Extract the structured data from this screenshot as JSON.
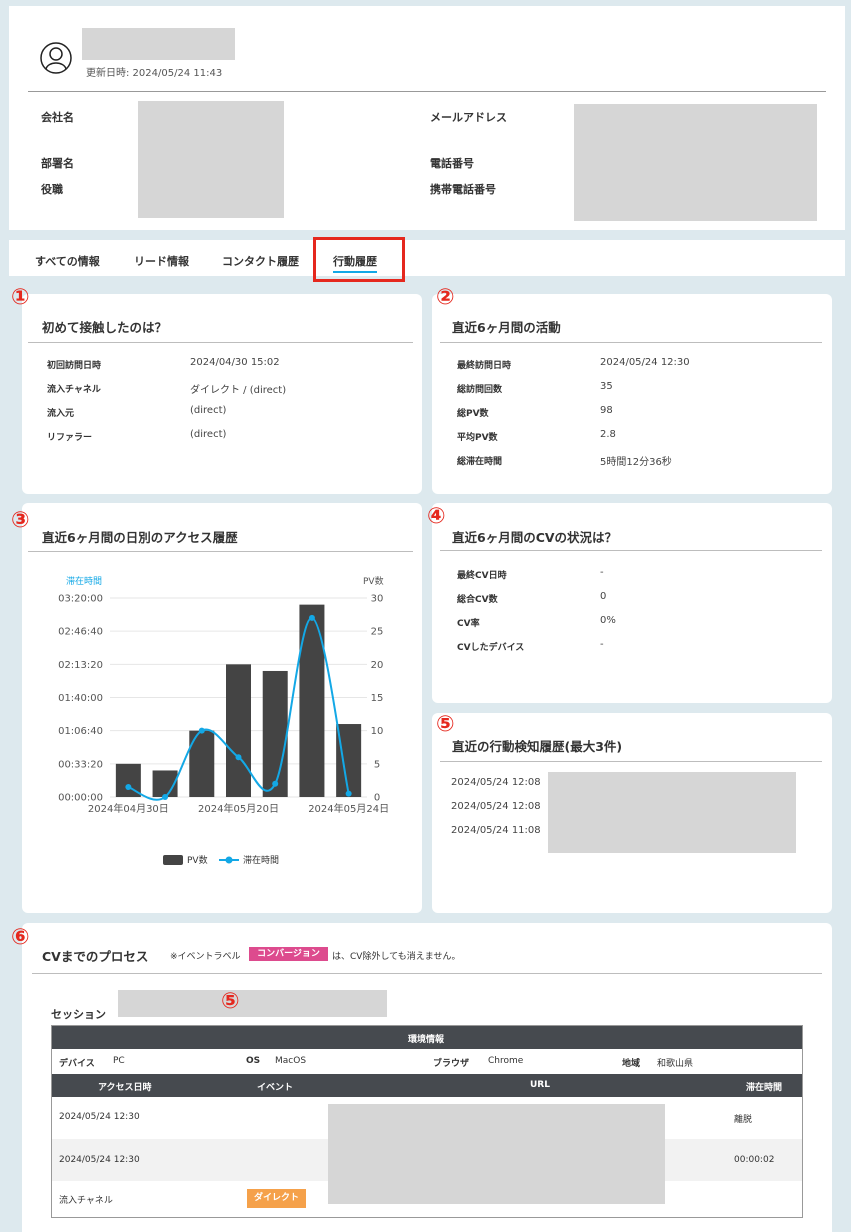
{
  "profile": {
    "updated": "更新日時: 2024/05/24 11:43"
  },
  "fields": {
    "company": "会社名",
    "department": "部署名",
    "position": "役職",
    "email": "メールアドレス",
    "phone": "電話番号",
    "mobile": "携帯電話番号"
  },
  "tabs": [
    "すべての情報",
    "リード情報",
    "コンタクト履歴",
    "行動履歴"
  ],
  "markers": [
    "①",
    "②",
    "③",
    "④",
    "⑤",
    "⑥"
  ],
  "first_contact": {
    "title": "初めて接触したのは？",
    "rows": [
      {
        "label": "初回訪問日時",
        "value": "2024/04/30 15:02"
      },
      {
        "label": "流入チャネル",
        "value": "ダイレクト / (direct)"
      },
      {
        "label": "流入元",
        "value": "(direct)"
      },
      {
        "label": "リファラー",
        "value": "(direct)"
      }
    ]
  },
  "activity": {
    "title": "直近6ヶ月間の活動",
    "rows": [
      {
        "label": "最終訪問日時",
        "value": "2024/05/24 12:30"
      },
      {
        "label": "総訪問回数",
        "value": "35"
      },
      {
        "label": "総PV数",
        "value": "98"
      },
      {
        "label": "平均PV数",
        "value": "2.8"
      },
      {
        "label": "総滞在時間",
        "value": "5時間12分36秒"
      }
    ]
  },
  "cv_status": {
    "title": "直近6ヶ月間のCVの状況は？",
    "rows": [
      {
        "label": "最終CV日時",
        "value": "-"
      },
      {
        "label": "総合CV数",
        "value": "0"
      },
      {
        "label": "CV率",
        "value": "0%"
      },
      {
        "label": "CVしたデバイス",
        "value": "-"
      }
    ]
  },
  "detections": {
    "title": "直近の行動検知履歴(最大3件)",
    "items": [
      "2024/05/24 12:08",
      "2024/05/24 12:08",
      "2024/05/24 11:08"
    ]
  },
  "chart_title": "直近6ヶ月間の日別のアクセス履歴",
  "chart_data": {
    "type": "bar",
    "left_axis_label": "滞在時間",
    "right_axis_label": "PV数",
    "left_ticks": [
      "03:20:00",
      "02:46:40",
      "02:13:20",
      "01:40:00",
      "01:06:40",
      "00:33:20",
      "00:00:00"
    ],
    "right_ticks": [
      "30",
      "25",
      "20",
      "15",
      "10",
      "5",
      "0"
    ],
    "x_ticks": [
      "2024年04月30日",
      "2024年05月20日",
      "2024年05月24日"
    ],
    "ylim_pv": [
      0,
      30
    ],
    "series": [
      {
        "name": "PV数",
        "kind": "bar",
        "color": "#444444",
        "values": [
          5,
          4,
          10,
          20,
          19,
          29,
          11
        ]
      },
      {
        "name": "滞在時間",
        "kind": "line",
        "color": "#13a8e6",
        "values_pv_scale": [
          1.5,
          0,
          10,
          6,
          2,
          27,
          0.5
        ]
      }
    ],
    "legend": "bottom-center"
  },
  "process": {
    "title": "CVまでのプロセス",
    "note_prefix": "※イベントラベル",
    "badge": "コンバージョン",
    "note_suffix": "は、CV除外しても消えません。",
    "session_label": "セッション",
    "env_header": "環境情報",
    "env": [
      {
        "label": "デバイス",
        "value": "PC"
      },
      {
        "label": "OS",
        "value": "MacOS"
      },
      {
        "label": "ブラウザ",
        "value": "Chrome"
      },
      {
        "label": "地域",
        "value": "和歌山県"
      }
    ],
    "columns": [
      "アクセス日時",
      "イベント",
      "URL",
      "滞在時間"
    ],
    "rows": [
      {
        "time": "2024/05/24 12:30",
        "stay": "離脱"
      },
      {
        "time": "2024/05/24 12:30",
        "stay": "00:00:02"
      }
    ],
    "channel_label": "流入チャネル",
    "channel_badge": "ダイレクト"
  },
  "colors": {
    "accent": "#13a8e6",
    "marker": "#e5281e",
    "badge_pink": "#dd4b8e",
    "badge_orange": "#f5a14a",
    "table_head": "#464a4f"
  }
}
